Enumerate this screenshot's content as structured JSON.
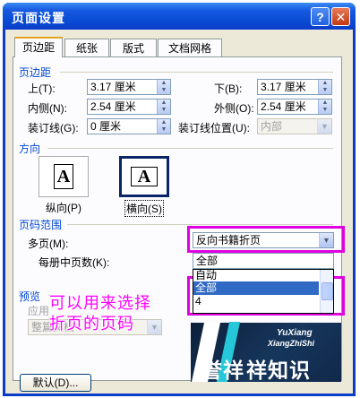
{
  "window": {
    "title": "页面设置",
    "help": "?",
    "close": "✕"
  },
  "tabs": [
    {
      "label": "页边距",
      "active": true
    },
    {
      "label": "纸张",
      "active": false
    },
    {
      "label": "版式",
      "active": false
    },
    {
      "label": "文档网格",
      "active": false
    }
  ],
  "margins": {
    "group_label": "页边距",
    "top_label": "上(T):",
    "top_value": "3.17 厘米",
    "bottom_label": "下(B):",
    "bottom_value": "3.17 厘米",
    "inside_label": "内侧(N):",
    "inside_value": "2.54 厘米",
    "outside_label": "外侧(O):",
    "outside_value": "2.54 厘米",
    "gutter_label": "装订线(G):",
    "gutter_value": "0 厘米",
    "gutter_pos_label": "装订线位置(U):",
    "gutter_pos_value": "内部"
  },
  "orientation": {
    "group_label": "方向",
    "portrait_label": "纵向(P)",
    "landscape_label": "横向(S)",
    "icon_glyph": "A",
    "selected": "landscape"
  },
  "pages": {
    "group_label": "页码范围",
    "multiple_label": "多页(M):",
    "multiple_value": "反向书籍折页",
    "per_booklet_label": "每册中页数(K):",
    "per_booklet_value": "全部",
    "list_items": [
      "自动",
      "全部",
      "4"
    ],
    "list_selected": "全部"
  },
  "preview": {
    "group_label": "预览",
    "apply_label": "应用",
    "apply_value": "整篇文档"
  },
  "annotation": {
    "line1": "可以用来选择",
    "line2": "折页的页码"
  },
  "watermark": {
    "latin1": "YuXiang",
    "latin2": "XiangZhiShi",
    "cjk_a": "誉祥",
    "cjk_b": "祥知识"
  },
  "footer": {
    "default_button": "默认(D)..."
  },
  "colors": {
    "title_bar": "#0a3cc8",
    "dialog_bg": "#ece9d8",
    "group_heading": "#0046d5",
    "highlight": "#e000e0",
    "selection": "#316ac5"
  }
}
